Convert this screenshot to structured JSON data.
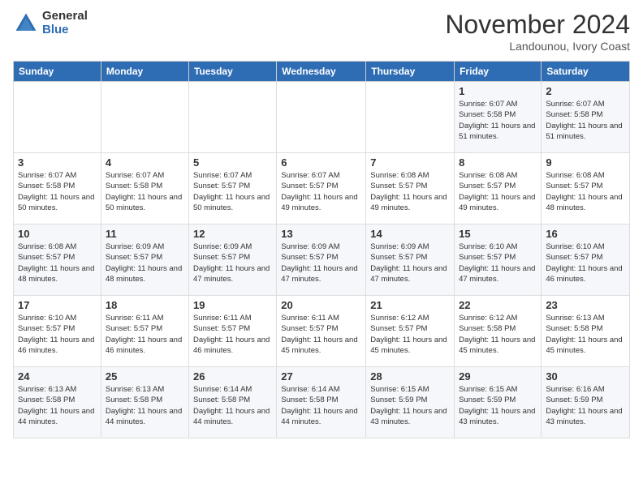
{
  "header": {
    "logo_general": "General",
    "logo_blue": "Blue",
    "month_title": "November 2024",
    "location": "Landounou, Ivory Coast"
  },
  "days_of_week": [
    "Sunday",
    "Monday",
    "Tuesday",
    "Wednesday",
    "Thursday",
    "Friday",
    "Saturday"
  ],
  "weeks": [
    [
      {
        "day": "",
        "info": ""
      },
      {
        "day": "",
        "info": ""
      },
      {
        "day": "",
        "info": ""
      },
      {
        "day": "",
        "info": ""
      },
      {
        "day": "",
        "info": ""
      },
      {
        "day": "1",
        "info": "Sunrise: 6:07 AM\nSunset: 5:58 PM\nDaylight: 11 hours and 51 minutes."
      },
      {
        "day": "2",
        "info": "Sunrise: 6:07 AM\nSunset: 5:58 PM\nDaylight: 11 hours and 51 minutes."
      }
    ],
    [
      {
        "day": "3",
        "info": "Sunrise: 6:07 AM\nSunset: 5:58 PM\nDaylight: 11 hours and 50 minutes."
      },
      {
        "day": "4",
        "info": "Sunrise: 6:07 AM\nSunset: 5:58 PM\nDaylight: 11 hours and 50 minutes."
      },
      {
        "day": "5",
        "info": "Sunrise: 6:07 AM\nSunset: 5:57 PM\nDaylight: 11 hours and 50 minutes."
      },
      {
        "day": "6",
        "info": "Sunrise: 6:07 AM\nSunset: 5:57 PM\nDaylight: 11 hours and 49 minutes."
      },
      {
        "day": "7",
        "info": "Sunrise: 6:08 AM\nSunset: 5:57 PM\nDaylight: 11 hours and 49 minutes."
      },
      {
        "day": "8",
        "info": "Sunrise: 6:08 AM\nSunset: 5:57 PM\nDaylight: 11 hours and 49 minutes."
      },
      {
        "day": "9",
        "info": "Sunrise: 6:08 AM\nSunset: 5:57 PM\nDaylight: 11 hours and 48 minutes."
      }
    ],
    [
      {
        "day": "10",
        "info": "Sunrise: 6:08 AM\nSunset: 5:57 PM\nDaylight: 11 hours and 48 minutes."
      },
      {
        "day": "11",
        "info": "Sunrise: 6:09 AM\nSunset: 5:57 PM\nDaylight: 11 hours and 48 minutes."
      },
      {
        "day": "12",
        "info": "Sunrise: 6:09 AM\nSunset: 5:57 PM\nDaylight: 11 hours and 47 minutes."
      },
      {
        "day": "13",
        "info": "Sunrise: 6:09 AM\nSunset: 5:57 PM\nDaylight: 11 hours and 47 minutes."
      },
      {
        "day": "14",
        "info": "Sunrise: 6:09 AM\nSunset: 5:57 PM\nDaylight: 11 hours and 47 minutes."
      },
      {
        "day": "15",
        "info": "Sunrise: 6:10 AM\nSunset: 5:57 PM\nDaylight: 11 hours and 47 minutes."
      },
      {
        "day": "16",
        "info": "Sunrise: 6:10 AM\nSunset: 5:57 PM\nDaylight: 11 hours and 46 minutes."
      }
    ],
    [
      {
        "day": "17",
        "info": "Sunrise: 6:10 AM\nSunset: 5:57 PM\nDaylight: 11 hours and 46 minutes."
      },
      {
        "day": "18",
        "info": "Sunrise: 6:11 AM\nSunset: 5:57 PM\nDaylight: 11 hours and 46 minutes."
      },
      {
        "day": "19",
        "info": "Sunrise: 6:11 AM\nSunset: 5:57 PM\nDaylight: 11 hours and 46 minutes."
      },
      {
        "day": "20",
        "info": "Sunrise: 6:11 AM\nSunset: 5:57 PM\nDaylight: 11 hours and 45 minutes."
      },
      {
        "day": "21",
        "info": "Sunrise: 6:12 AM\nSunset: 5:57 PM\nDaylight: 11 hours and 45 minutes."
      },
      {
        "day": "22",
        "info": "Sunrise: 6:12 AM\nSunset: 5:58 PM\nDaylight: 11 hours and 45 minutes."
      },
      {
        "day": "23",
        "info": "Sunrise: 6:13 AM\nSunset: 5:58 PM\nDaylight: 11 hours and 45 minutes."
      }
    ],
    [
      {
        "day": "24",
        "info": "Sunrise: 6:13 AM\nSunset: 5:58 PM\nDaylight: 11 hours and 44 minutes."
      },
      {
        "day": "25",
        "info": "Sunrise: 6:13 AM\nSunset: 5:58 PM\nDaylight: 11 hours and 44 minutes."
      },
      {
        "day": "26",
        "info": "Sunrise: 6:14 AM\nSunset: 5:58 PM\nDaylight: 11 hours and 44 minutes."
      },
      {
        "day": "27",
        "info": "Sunrise: 6:14 AM\nSunset: 5:58 PM\nDaylight: 11 hours and 44 minutes."
      },
      {
        "day": "28",
        "info": "Sunrise: 6:15 AM\nSunset: 5:59 PM\nDaylight: 11 hours and 43 minutes."
      },
      {
        "day": "29",
        "info": "Sunrise: 6:15 AM\nSunset: 5:59 PM\nDaylight: 11 hours and 43 minutes."
      },
      {
        "day": "30",
        "info": "Sunrise: 6:16 AM\nSunset: 5:59 PM\nDaylight: 11 hours and 43 minutes."
      }
    ]
  ]
}
